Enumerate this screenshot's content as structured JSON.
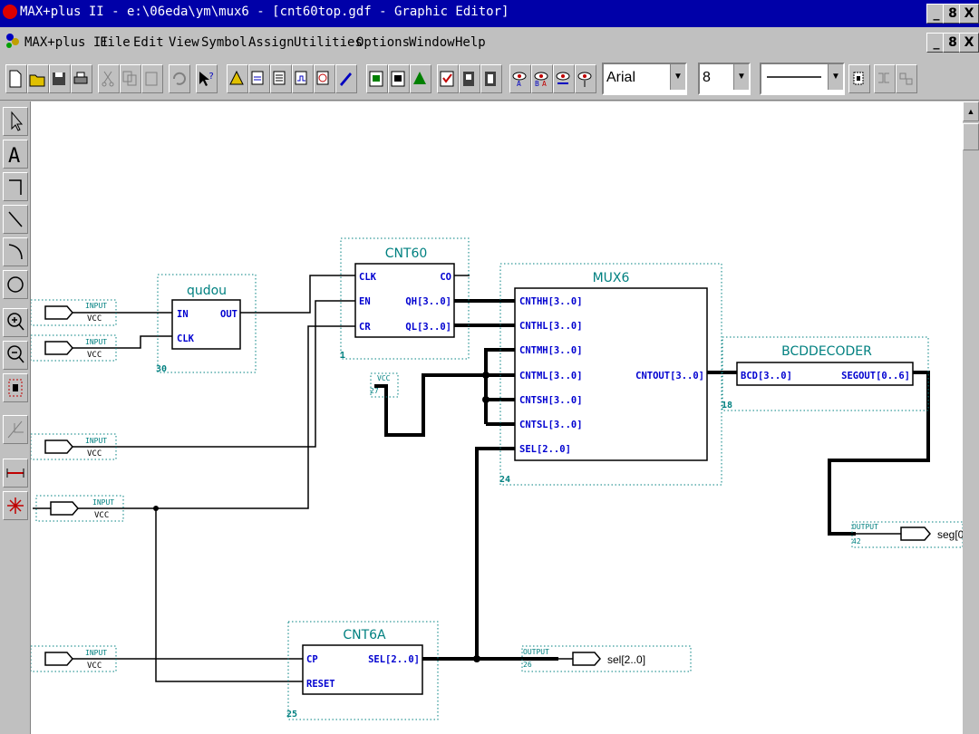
{
  "window": {
    "title": "MAX+plus II - e:\\06eda\\ym\\mux6 - [cnt60top.gdf - Graphic Editor]"
  },
  "window_buttons": [
    "_",
    "8",
    "X"
  ],
  "menu": [
    "MAX+plus II",
    "File",
    "Edit",
    "View",
    "Symbol",
    "Assign",
    "Utilities",
    "Options",
    "Window",
    "Help"
  ],
  "toolbar": {
    "font": "Arial",
    "size": "8"
  },
  "schematic": {
    "blocks": {
      "qudou": {
        "name": "qudou",
        "num": "30",
        "pins_in": [
          "IN",
          "CLK"
        ],
        "pins_out": [
          "OUT"
        ]
      },
      "cnt60": {
        "name": "CNT60",
        "num": "1",
        "pins_in": [
          "CLK",
          "EN",
          "CR"
        ],
        "pins_out": [
          "CO",
          "QH[3..0]",
          "QL[3..0]"
        ]
      },
      "mux6": {
        "name": "MUX6",
        "num": "24",
        "pins_in": [
          "CNTHH[3..0]",
          "CNTHL[3..0]",
          "CNTMH[3..0]",
          "CNTML[3..0]",
          "CNTSH[3..0]",
          "CNTSL[3..0]",
          "SEL[2..0]"
        ],
        "pins_out": [
          "CNTOUT[3..0]"
        ]
      },
      "bcd": {
        "name": "BCDDECODER",
        "num": "18",
        "pins_in": [
          "BCD[3..0]"
        ],
        "pins_out": [
          "SEGOUT[0..6]"
        ]
      },
      "cnt6a": {
        "name": "CNT6A",
        "num": "25",
        "pins_in": [
          "CP",
          "RESET"
        ],
        "pins_out": [
          "SEL[2..0]"
        ]
      }
    },
    "inputs": [
      {
        "label": "INPUT",
        "value": "VCC"
      },
      {
        "label": "INPUT",
        "value": "VCC"
      },
      {
        "label": "INPUT",
        "value": "VCC"
      },
      {
        "label": "INPUT",
        "value": "VCC"
      },
      {
        "label": "INPUT",
        "value": "VCC"
      }
    ],
    "vcc_symbol": {
      "label": "VCC",
      "num": "27"
    },
    "outputs": [
      {
        "label": "OUTPUT",
        "num": "42",
        "name": "seg[0"
      },
      {
        "label": "OUTPUT",
        "num": "26",
        "name": "sel[2..0]"
      }
    ]
  }
}
